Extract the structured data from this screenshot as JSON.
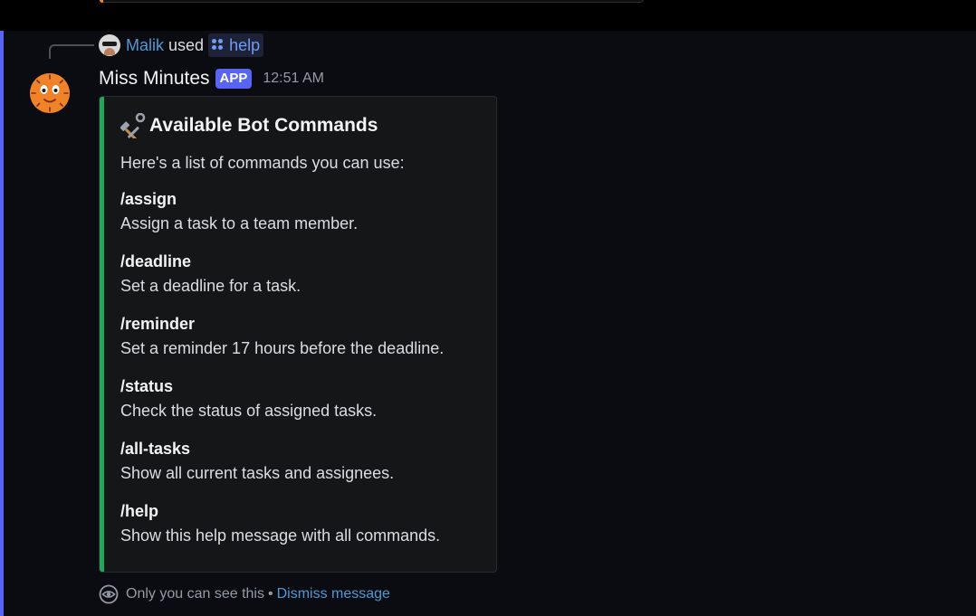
{
  "reply": {
    "user": "Malik",
    "used_text": "used",
    "command": "help",
    "user_color": "#4d9ad5"
  },
  "message": {
    "author": "Miss Minutes",
    "app_tag": "APP",
    "timestamp": "12:51 AM",
    "avatar_icon": "clock-face-avatar"
  },
  "embed": {
    "accent_color": "#23a55a",
    "title_icon": "hammer-and-wrench-icon",
    "title": "Available Bot Commands",
    "description": "Here's a list of commands you can use:",
    "commands": [
      {
        "name": "/assign",
        "desc": "Assign a task to a team member."
      },
      {
        "name": "/deadline",
        "desc": "Set a deadline for a task."
      },
      {
        "name": "/reminder",
        "desc": "Set a reminder 17 hours before the deadline."
      },
      {
        "name": "/status",
        "desc": "Check the status of assigned tasks."
      },
      {
        "name": "/all-tasks",
        "desc": "Show all current tasks and assignees."
      },
      {
        "name": "/help",
        "desc": "Show this help message with all commands."
      }
    ]
  },
  "footer": {
    "notice": "Only you can see this",
    "separator": "•",
    "dismiss": "Dismiss message"
  },
  "colors": {
    "highlight": "#5865f2",
    "app_tag": "#5865f2",
    "link": "#4d9ad5"
  }
}
